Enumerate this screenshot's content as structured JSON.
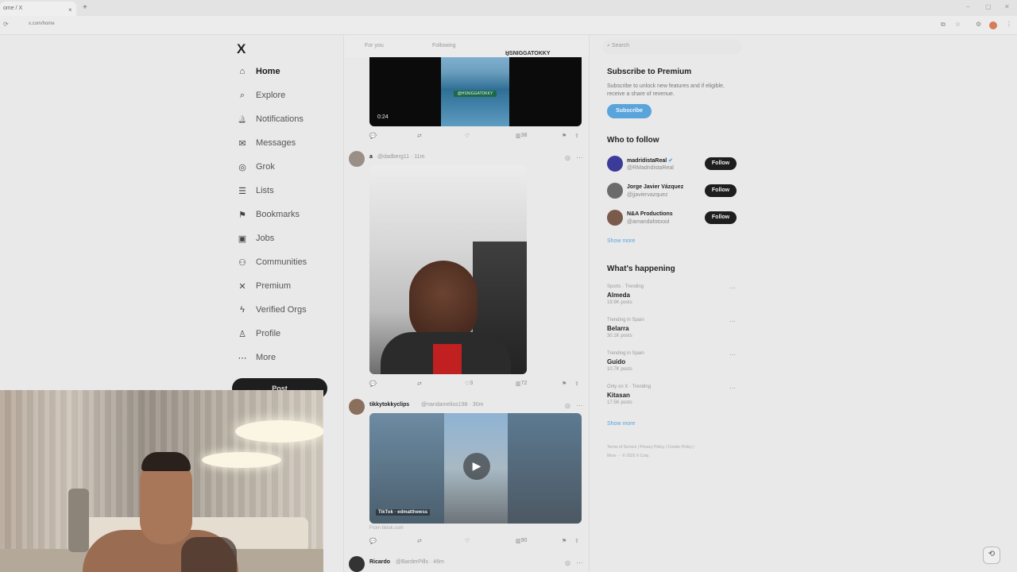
{
  "browser": {
    "tab_title": "ome / X",
    "tab_close": "×",
    "new_tab": "+",
    "url": "x.com/home",
    "window_controls": [
      "–",
      "▢",
      "✕"
    ]
  },
  "nav": {
    "logo": "X",
    "items": [
      {
        "label": "Home",
        "icon": "home-icon",
        "glyph": "⌂"
      },
      {
        "label": "Explore",
        "icon": "search-icon",
        "glyph": "⌕"
      },
      {
        "label": "Notifications",
        "icon": "bell-icon",
        "glyph": "🔔"
      },
      {
        "label": "Messages",
        "icon": "envelope-icon",
        "glyph": "✉"
      },
      {
        "label": "Grok",
        "icon": "grok-icon",
        "glyph": "◎"
      },
      {
        "label": "Lists",
        "icon": "list-icon",
        "glyph": "☰"
      },
      {
        "label": "Bookmarks",
        "icon": "bookmark-icon",
        "glyph": "⚑"
      },
      {
        "label": "Jobs",
        "icon": "briefcase-icon",
        "glyph": "▣"
      },
      {
        "label": "Communities",
        "icon": "people-icon",
        "glyph": "⚇"
      },
      {
        "label": "Premium",
        "icon": "x-icon",
        "glyph": "✕"
      },
      {
        "label": "Verified Orgs",
        "icon": "lightning-icon",
        "glyph": "ϟ"
      },
      {
        "label": "Profile",
        "icon": "person-icon",
        "glyph": "♙"
      },
      {
        "label": "More",
        "icon": "more-circle-icon",
        "glyph": "⋯"
      }
    ],
    "post_label": "Post"
  },
  "feed": {
    "tabs": {
      "for_you": "For you",
      "following": "Following",
      "custom": "HSNIGGATOKKY"
    },
    "video1": {
      "time": "0:24",
      "overlay": "@HSNIGGATOKKY",
      "views": "38"
    },
    "post2": {
      "name": "a",
      "handle": "@dadberg11 · 11m",
      "reposts": "",
      "likes": "3",
      "views": "72"
    },
    "post3": {
      "name": "tikkytokkyclips",
      "handle": "@nandamelios198 · 30m",
      "caption": "TikTok · edmatthewss",
      "source": "From tiktok.com",
      "views": "90"
    },
    "post4": {
      "name": "Ricardo",
      "handle": "@BarderPills · 46m"
    }
  },
  "right": {
    "search_placeholder": "Search",
    "premium": {
      "title": "Subscribe to Premium",
      "text": "Subscribe to unlock new features and if eligible, receive a share of revenue.",
      "button": "Subscribe"
    },
    "who_to_follow": {
      "title": "Who to follow",
      "items": [
        {
          "name": "madridistaReal",
          "handle": "@RMadridistaReal",
          "button": "Follow",
          "avatar_color": "#3b3b9a"
        },
        {
          "name": "Jorge Javier Vázquez",
          "handle": "@jjaviervazquez",
          "button": "Follow",
          "avatar_color": "#6b6b6b"
        },
        {
          "name": "N&A Productions",
          "handle": "@amandafotoool",
          "button": "Follow",
          "avatar_color": "#7a5a4a"
        }
      ],
      "show_more": "Show more"
    },
    "whats_happening": {
      "title": "What's happening",
      "items": [
        {
          "context": "Sports · Trending",
          "topic": "Almeda",
          "posts": "19.9K posts"
        },
        {
          "context": "Trending in Spain",
          "topic": "Belarra",
          "posts": "30.1K posts"
        },
        {
          "context": "Trending in Spain",
          "topic": "Guido",
          "posts": "10.7K posts"
        },
        {
          "context": "Only on X · Trending",
          "topic": "Kitasan",
          "posts": "17.5K posts"
        }
      ],
      "show_more": "Show more"
    },
    "footer": [
      "Terms of Service",
      "Privacy Policy",
      "Cookie Policy",
      "More ···",
      "© 2025 X Corp."
    ]
  }
}
